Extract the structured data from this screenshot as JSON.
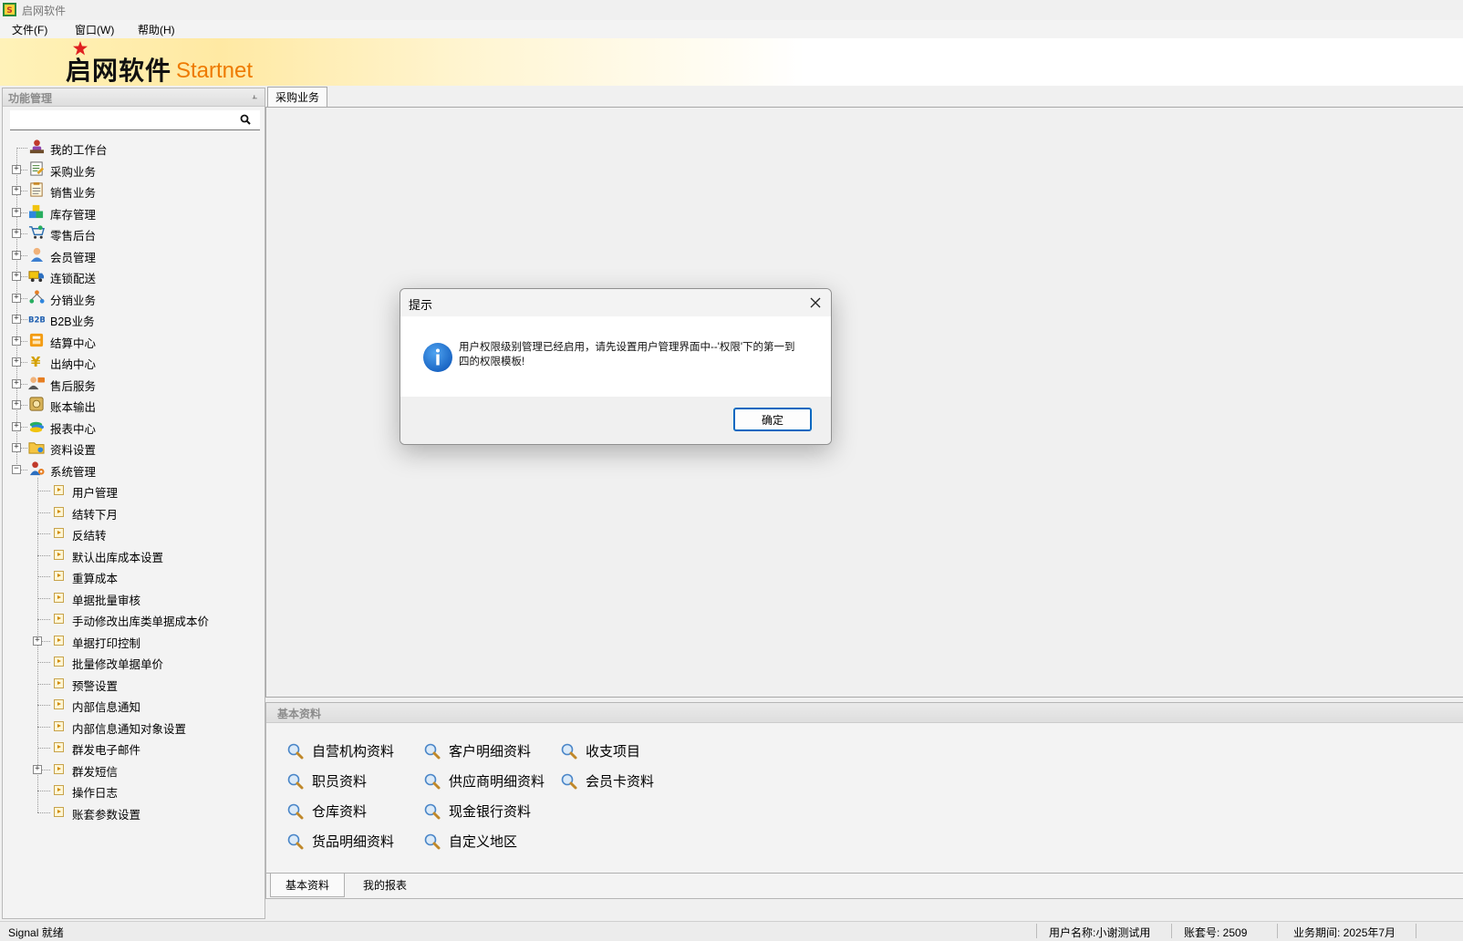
{
  "window": {
    "title": "启网软件"
  },
  "menu": [
    "文件(F)",
    "窗口(W)",
    "帮助(H)"
  ],
  "banner": {
    "logo_cn": "启网软件",
    "logo_en": "Startnet"
  },
  "left_panel": {
    "title": "功能管理",
    "pin_glyph": "📌",
    "search_value": "",
    "tree": [
      {
        "label": "我的工作台",
        "icon": "user-desk-icon",
        "expand": ""
      },
      {
        "label": "采购业务",
        "icon": "purchase-icon",
        "expand": "+"
      },
      {
        "label": "销售业务",
        "icon": "sales-icon",
        "expand": "+"
      },
      {
        "label": "库存管理",
        "icon": "inventory-icon",
        "expand": "+"
      },
      {
        "label": "零售后台",
        "icon": "cart-icon",
        "expand": "+"
      },
      {
        "label": "会员管理",
        "icon": "member-icon",
        "expand": "+"
      },
      {
        "label": "连锁配送",
        "icon": "truck-icon",
        "expand": "+"
      },
      {
        "label": "分销业务",
        "icon": "distribution-icon",
        "expand": "+"
      },
      {
        "label": "B2B业务",
        "icon": "b2b-icon",
        "expand": "+"
      },
      {
        "label": "结算中心",
        "icon": "settlement-icon",
        "expand": "+"
      },
      {
        "label": "出纳中心",
        "icon": "yen-icon",
        "expand": "+"
      },
      {
        "label": "售后服务",
        "icon": "service-icon",
        "expand": "+"
      },
      {
        "label": "账本输出",
        "icon": "ledger-icon",
        "expand": "+"
      },
      {
        "label": "报表中心",
        "icon": "report-icon",
        "expand": "+"
      },
      {
        "label": "资料设置",
        "icon": "folder-icon",
        "expand": "+"
      },
      {
        "label": "系统管理",
        "icon": "system-icon",
        "expand": "−"
      }
    ],
    "children": [
      {
        "label": "用户管理",
        "expand": ""
      },
      {
        "label": "结转下月",
        "expand": ""
      },
      {
        "label": "反结转",
        "expand": ""
      },
      {
        "label": "默认出库成本设置",
        "expand": ""
      },
      {
        "label": "重算成本",
        "expand": ""
      },
      {
        "label": "单据批量审核",
        "expand": ""
      },
      {
        "label": "手动修改出库类单据成本价",
        "expand": ""
      },
      {
        "label": "单据打印控制",
        "expand": "+"
      },
      {
        "label": "批量修改单据单价",
        "expand": ""
      },
      {
        "label": "预警设置",
        "expand": ""
      },
      {
        "label": "内部信息通知",
        "expand": ""
      },
      {
        "label": "内部信息通知对象设置",
        "expand": ""
      },
      {
        "label": "群发电子邮件",
        "expand": ""
      },
      {
        "label": "群发短信",
        "expand": "+"
      },
      {
        "label": "操作日志",
        "expand": ""
      },
      {
        "label": "账套参数设置",
        "expand": ""
      }
    ]
  },
  "main": {
    "tab_label": "采购业务"
  },
  "bottom_panel": {
    "title": "基本资料",
    "columns": [
      [
        "自营机构资料",
        "职员资料",
        "仓库资料",
        "货品明细资料"
      ],
      [
        "客户明细资料",
        "供应商明细资料",
        "现金银行资料",
        "自定义地区"
      ],
      [
        "收支项目",
        "会员卡资料"
      ]
    ],
    "tabs": [
      "基本资料",
      "我的报表"
    ]
  },
  "status": {
    "left": "Signal 就绪",
    "user": "用户名称:小谢测试用",
    "account": "账套号: 2509",
    "period": "业务期间: 2025年7月"
  },
  "dialog": {
    "title": "提示",
    "message": "用户权限级别管理已经启用，请先设置用户管理界面中--'权限'下的第一到四的权限模板!",
    "ok_label": "确定"
  },
  "colors": {
    "logo_en": "#ee7a00",
    "dialog_info": "#1e6fd0",
    "ok_border": "#0067c0"
  }
}
